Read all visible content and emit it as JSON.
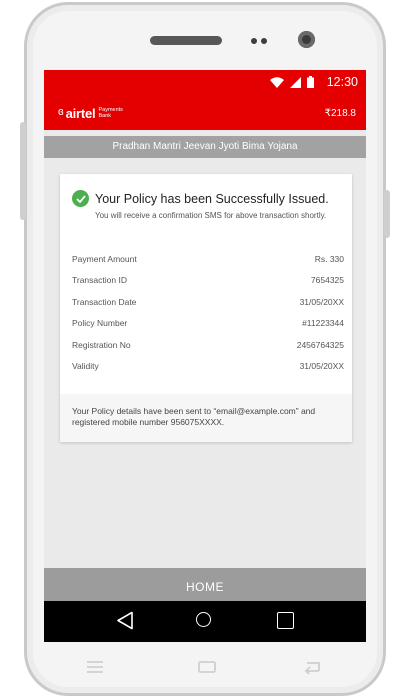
{
  "status_bar": {
    "time": "12:30"
  },
  "header": {
    "brand": "airtel",
    "brand_sub": "Payments Bank",
    "balance": "₹218.8"
  },
  "page_title": "Pradhan Mantri Jeevan Jyoti Bima Yojana",
  "confirmation": {
    "title": "Your Policy has been Successfully  Issued.",
    "subtitle": "You will receive a confirmation SMS for above transaction shortly."
  },
  "details": [
    {
      "label": "Payment Amount",
      "value": "Rs. 330"
    },
    {
      "label": "Transaction ID",
      "value": "7654325"
    },
    {
      "label": "Transaction Date",
      "value": "31/05/20XX"
    },
    {
      "label": "Policy Number",
      "value": "#11223344"
    },
    {
      "label": "Registration No",
      "value": "2456764325"
    },
    {
      "label": "Validity",
      "value": "31/05/20XX"
    }
  ],
  "note": "Your Policy details have been sent to “email@example.com” and registered mobile number 956075XXXX.",
  "home_label": "HOME",
  "colors": {
    "brand_red": "#e40000",
    "success_green": "#4caf50",
    "bar_gray": "#a2a2a2"
  }
}
